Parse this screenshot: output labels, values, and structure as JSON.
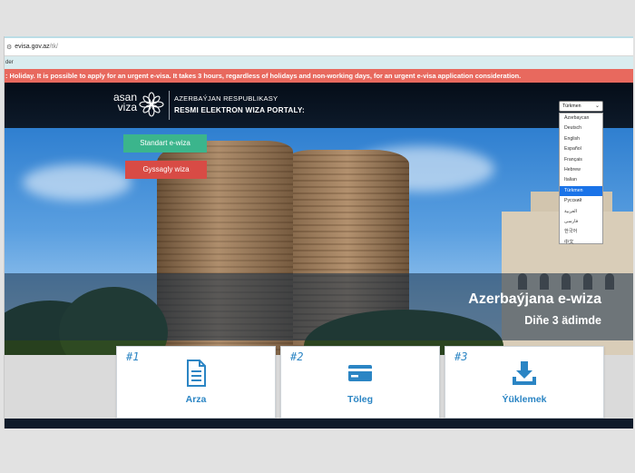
{
  "browser": {
    "url_domain": "evisa.gov.az",
    "url_path": "/tk/",
    "bookmark_fragment": "der"
  },
  "notice": {
    "text": ": Holiday. It is possible to apply for an urgent e-visa. It takes 3 hours, regardless of holidays and non-working days, for an urgent e-visa application consideration."
  },
  "header": {
    "logo_line1": "asan",
    "logo_line2": "viza",
    "line1": "AZERBAÝJAN RESPUBLIKASY",
    "line2": "RESMI ELEKTRON WIZA PORTALY:"
  },
  "language": {
    "selected": "Türkmen",
    "options": [
      "Azərbaycan",
      "Deutsch",
      "English",
      "Español",
      "Français",
      "Hebrew",
      "Italian",
      "Türkmen",
      "Русский",
      "العربية",
      "فارسی",
      "한국어",
      "中文"
    ]
  },
  "buttons": {
    "standard": "Standart e-wiza",
    "urgent": "Gyssagly wiza"
  },
  "hero": {
    "title": "Azerbaýjana e-wiza",
    "subtitle": "Diňe 3 ädimde"
  },
  "steps": [
    {
      "num": "#1",
      "label": "Arza",
      "icon": "document-icon"
    },
    {
      "num": "#2",
      "label": "Töleg",
      "icon": "credit-card-icon"
    },
    {
      "num": "#3",
      "label": "Ýüklemek",
      "icon": "download-icon"
    }
  ],
  "colors": {
    "notice_bg": "#e8695e",
    "header_bg": "#0d1a2a",
    "standard_btn": "#3bb58c",
    "urgent_btn": "#d84b45",
    "accent_blue": "#2b85c4",
    "selected_option": "#1a73e8"
  }
}
